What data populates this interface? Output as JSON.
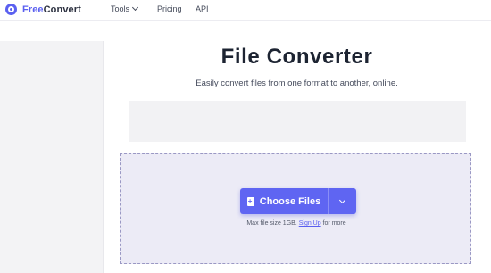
{
  "header": {
    "brand_part1": "Free",
    "brand_part2": "Convert",
    "nav": {
      "tools": "Tools",
      "pricing": "Pricing",
      "api": "API"
    }
  },
  "main": {
    "title": "File Converter",
    "subtitle": "Easily convert files from one format to another, online."
  },
  "upload": {
    "choose_label": "Choose Files",
    "note_prefix": "Max file size 1GB.",
    "signup_link": "Sign Up",
    "note_suffix": "for more"
  },
  "colors": {
    "accent": "#5f65f2",
    "brand": "#5b60f0",
    "dropzone_bg": "#ecebf6"
  },
  "icons": [
    "logo-icon",
    "chevron-down-icon",
    "file-plus-icon"
  ]
}
